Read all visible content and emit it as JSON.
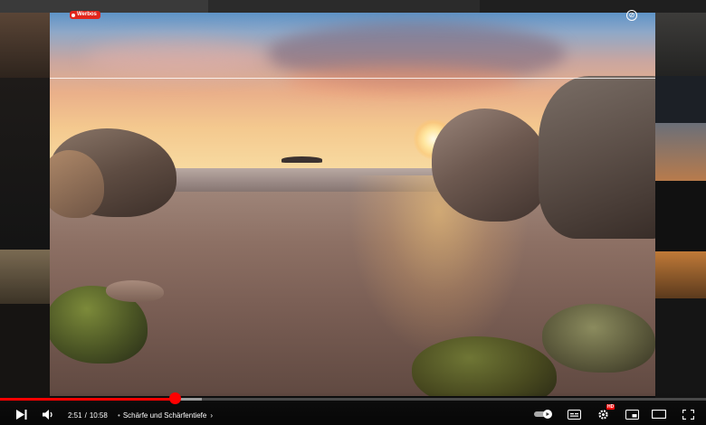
{
  "badge": {
    "label": "Werbos"
  },
  "player": {
    "current_time": "2:51",
    "separator": "/",
    "duration": "10:58",
    "chapter": "Schärfe und Schärfentiefe",
    "chapter_arrow": "›",
    "progress_fraction": 0.248,
    "loaded_fraction": 0.286
  },
  "icons": {
    "top_right": "hide-icon",
    "next": "next-icon",
    "volume": "volume-icon",
    "autoplay": "autoplay-toggle-icon",
    "subtitles": "subtitles-icon",
    "settings": "gear-icon",
    "miniplayer": "miniplayer-icon",
    "theater": "theater-icon",
    "fullscreen": "fullscreen-icon"
  },
  "settings_badge": "HD",
  "colors": {
    "accent": "#ff0000",
    "badge": "#e1261c"
  }
}
